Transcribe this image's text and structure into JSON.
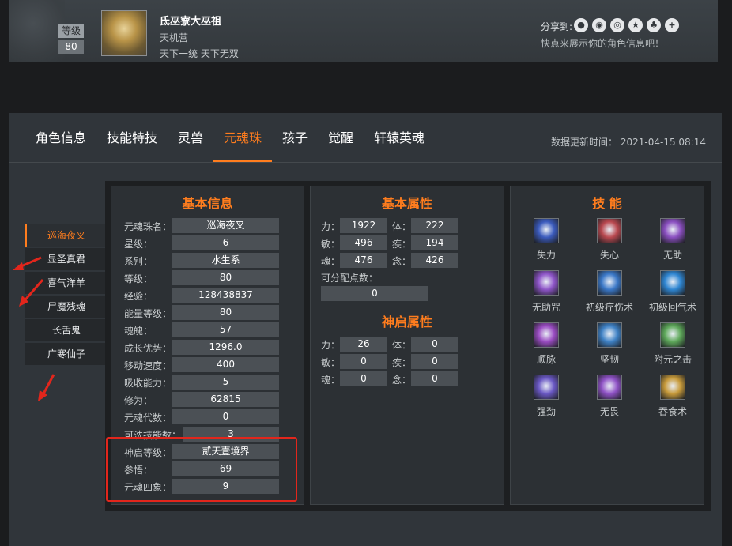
{
  "profile": {
    "level_label": "等级",
    "level_value": "80",
    "name": "氐巫寮大巫祖",
    "server": "天机营",
    "guild": "天下一统 天下无双",
    "share_label": "分享到:",
    "share_icons": [
      "wechat-icon",
      "qq-icon",
      "weibo-icon",
      "qzone-icon",
      "tieba-icon",
      "more-icon"
    ],
    "share_hint": "快点来展示你的角色信息吧！"
  },
  "tabs": [
    "角色信息",
    "技能特技",
    "灵兽",
    "元魂珠",
    "孩子",
    "觉醒",
    "轩辕英魂"
  ],
  "active_tab": "元魂珠",
  "update_time": "数据更新时间： 2021-04-15 08:14",
  "side_items": [
    "巡海夜叉",
    "显圣真君",
    "喜气洋羊",
    "尸魔残魂",
    "长舌鬼",
    "广寒仙子"
  ],
  "active_side": "巡海夜叉",
  "basic_info": {
    "title": "基本信息",
    "rows": [
      {
        "label": "元魂珠名：",
        "value": "巡海夜叉"
      },
      {
        "label": "星级：",
        "value": "6"
      },
      {
        "label": "系别：",
        "value": "水生系"
      },
      {
        "label": "等级：",
        "value": "80"
      },
      {
        "label": "经验：",
        "value": "128438837"
      },
      {
        "label": "能量等级：",
        "value": "80"
      },
      {
        "label": "魂魄：",
        "value": "57"
      },
      {
        "label": "成长优势：",
        "value": "1296.0"
      },
      {
        "label": "移动速度：",
        "value": "400"
      },
      {
        "label": "吸收能力：",
        "value": "5"
      },
      {
        "label": "修为：",
        "value": "62815"
      },
      {
        "label": "元魂代数：",
        "value": "0"
      },
      {
        "label": "可洗技能数：",
        "value": "3"
      },
      {
        "label": "神启等级：",
        "value": "贰天壹境界"
      },
      {
        "label": "参悟：",
        "value": "69"
      },
      {
        "label": "元魂四象：",
        "value": "9"
      }
    ]
  },
  "basic_attr": {
    "title": "基本属性",
    "rows": [
      [
        {
          "label": "力：",
          "value": "1922"
        },
        {
          "label": "体：",
          "value": "222"
        }
      ],
      [
        {
          "label": "敏：",
          "value": "496"
        },
        {
          "label": "疾：",
          "value": "194"
        }
      ],
      [
        {
          "label": "魂：",
          "value": "476"
        },
        {
          "label": "念：",
          "value": "426"
        }
      ]
    ],
    "free_points_label": "可分配点数：",
    "free_points_value": "0"
  },
  "shenqi_attr": {
    "title": "神启属性",
    "rows": [
      [
        {
          "label": "力：",
          "value": "26"
        },
        {
          "label": "体：",
          "value": "0"
        }
      ],
      [
        {
          "label": "敏：",
          "value": "0"
        },
        {
          "label": "疾：",
          "value": "0"
        }
      ],
      [
        {
          "label": "魂：",
          "value": "0"
        },
        {
          "label": "念：",
          "value": "0"
        }
      ]
    ]
  },
  "skills": {
    "title": "技 能",
    "items": [
      {
        "name": "失力",
        "icon": "shili-skill-icon",
        "color": "#3b5bbd"
      },
      {
        "name": "失心",
        "icon": "shixin-skill-icon",
        "color": "#b9484f"
      },
      {
        "name": "无助",
        "icon": "wuzhu-skill-icon",
        "color": "#8a4fc0"
      },
      {
        "name": "无助咒",
        "icon": "wuzhuzhou-skill-icon",
        "color": "#8e55c8"
      },
      {
        "name": "初级疗伤术",
        "icon": "liaoshang-skill-icon",
        "color": "#3a78c8"
      },
      {
        "name": "初级回气术",
        "icon": "huiqi-skill-icon",
        "color": "#2f86d2"
      },
      {
        "name": "顺脉",
        "icon": "shunmai-skill-icon",
        "color": "#9a4cc2"
      },
      {
        "name": "坚韧",
        "icon": "jianren-skill-icon",
        "color": "#3f82c6"
      },
      {
        "name": "附元之击",
        "icon": "fuyuan-skill-icon",
        "color": "#5ea85a"
      },
      {
        "name": "强劲",
        "icon": "qiangjin-skill-icon",
        "color": "#6a58c4"
      },
      {
        "name": "无畏",
        "icon": "wuwei-skill-icon",
        "color": "#8f52c6"
      },
      {
        "name": "吞食术",
        "icon": "tunshi-skill-icon",
        "color": "#c79a3a"
      }
    ]
  },
  "colors": {
    "accent": "#ff7d1e",
    "annotation": "#e2261c"
  }
}
